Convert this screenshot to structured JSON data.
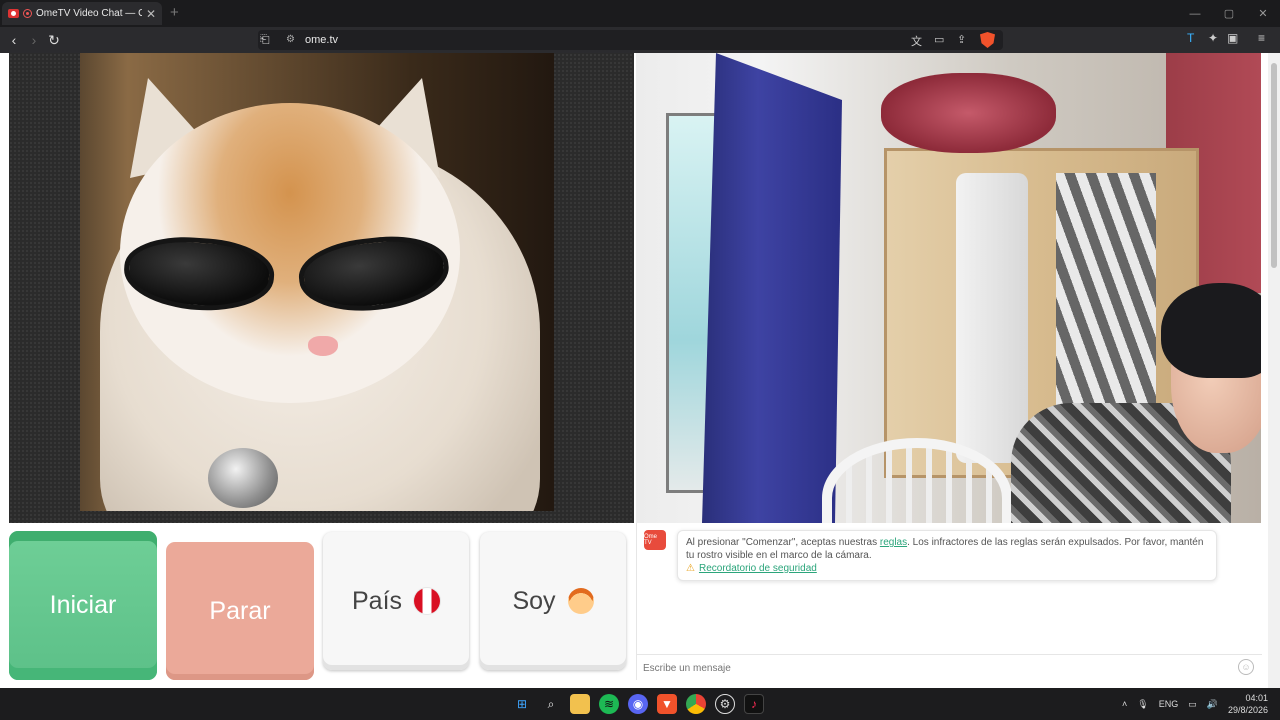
{
  "browser": {
    "tab_title": "OmeTV Video Chat — Omeg",
    "close": "✕",
    "new_tab": "+",
    "url": "ome.tv",
    "win_min": "—",
    "win_max": "▢",
    "win_close": "✕"
  },
  "buttons": {
    "start": "Iniciar",
    "stop": "Parar",
    "country": "País",
    "gender": "Soy"
  },
  "chat": {
    "logo_text": "Ome TV",
    "notice_prefix": "Al presionar \"Comenzar\", aceptas nuestras ",
    "notice_link": "reglas",
    "notice_suffix": ". Los infractores de las reglas serán expulsados. Por favor, mantén tu rostro visible en el marco de la cámara.",
    "safety_link": "Recordatorio de seguridad",
    "input_placeholder": "Escribe un mensaje"
  },
  "taskbar": {
    "language": "ENG",
    "time": "04:01",
    "date": "29/8/2026"
  },
  "colors": {
    "start": "#5cc088",
    "stop": "#eba999",
    "link": "#2ba57b",
    "flag_peru": "#d91023"
  }
}
